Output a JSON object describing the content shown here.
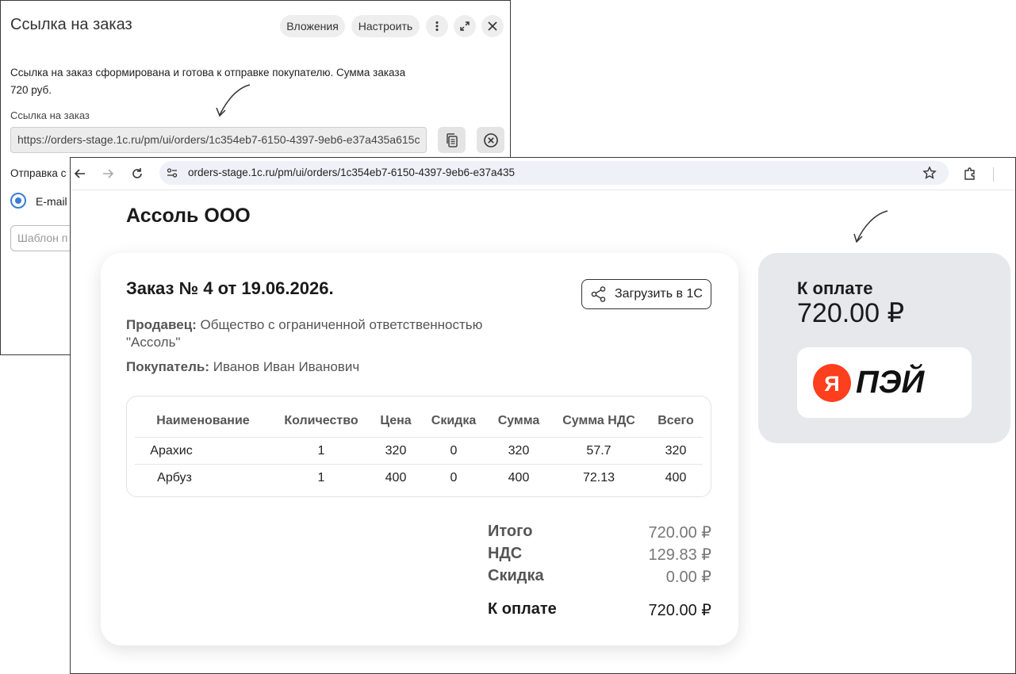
{
  "dialog": {
    "title": "Ссылка на заказ",
    "attachments_label": "Вложения",
    "settings_label": "Настроить",
    "message": "Ссылка на заказ сформирована и готова к отправке покупателю. Сумма заказа 720 руб.",
    "link_label": "Ссылка на заказ",
    "link_value": "https://orders-stage.1c.ru/pm/ui/orders/1c354eb7-6150-4397-9eb6-e37a435a615c",
    "send_label": "Отправка с",
    "radio_email": "E-mail",
    "template_placeholder": "Шаблон п"
  },
  "browser": {
    "url": "orders-stage.1c.ru/pm/ui/orders/1c354eb7-6150-4397-9eb6-e37a435"
  },
  "page": {
    "company": "Ассоль ООО",
    "order_title": "Заказ № 4 от 19.06.2026.",
    "load_button": "Загрузить в 1С",
    "seller_label": "Продавец:",
    "seller_value": "Общество с ограниченной ответственностью \"Ассоль\"",
    "buyer_label": "Покупатель:",
    "buyer_value": "Иванов Иван Иванович",
    "table": {
      "headers": [
        "Наименование",
        "Количество",
        "Цена",
        "Скидка",
        "Сумма",
        "Сумма НДС",
        "Всего"
      ],
      "rows": [
        [
          "Арахис",
          "1",
          "320",
          "0",
          "320",
          "57.7",
          "320"
        ],
        [
          "Арбуз",
          "1",
          "400",
          "0",
          "400",
          "72.13",
          "400"
        ]
      ]
    },
    "totals": {
      "total_label": "Итого",
      "total_value": "720.00 ₽",
      "vat_label": "НДС",
      "vat_value": "129.83 ₽",
      "discount_label": "Скидка",
      "discount_value": "0.00 ₽",
      "pay_label": "К оплате",
      "pay_value": "720.00 ₽"
    },
    "pay_card": {
      "label": "К оплате",
      "amount": "720.00 ₽",
      "brand_letter": "Я",
      "brand_text": "ПЭЙ"
    }
  },
  "colors": {
    "accent_blue": "#3b7dd8",
    "yandex_red": "#fc3f1d",
    "pay_card_bg": "#e7e8ec"
  }
}
